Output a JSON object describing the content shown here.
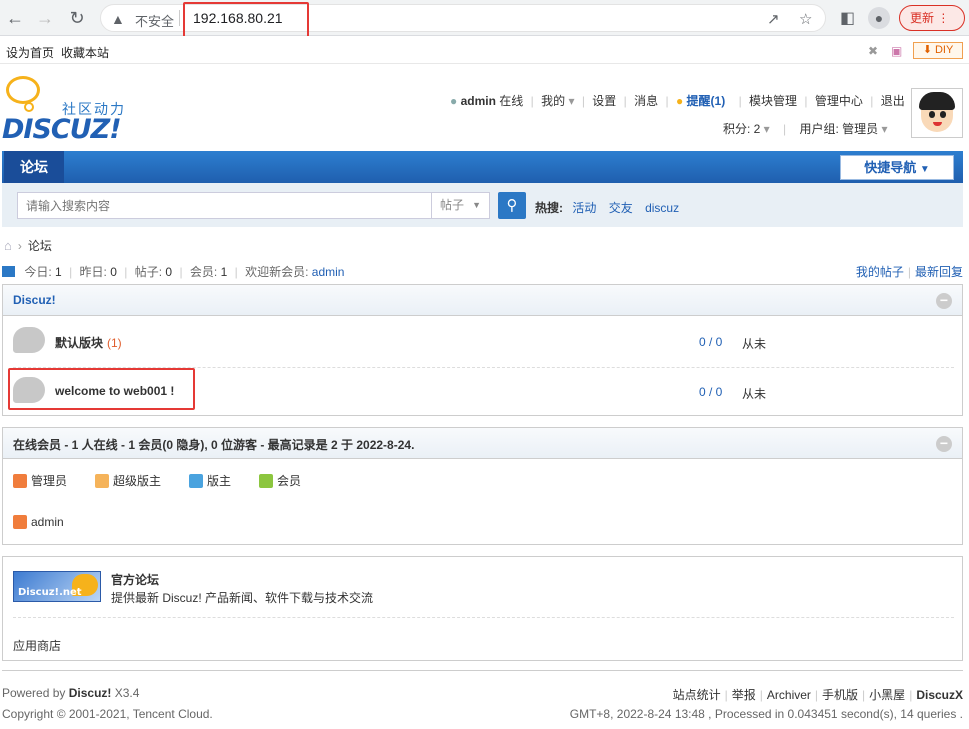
{
  "browser": {
    "insecure_label": "不安全",
    "url": "192.168.80.21",
    "update_label": "更新",
    "bookmarks": [
      "设为首页",
      "收藏本站"
    ],
    "diy_label": "DIY"
  },
  "logo": {
    "slogan": "社区动力",
    "brand": "DISCUZ!"
  },
  "userbar": {
    "username": "admin",
    "status": "在线",
    "links": [
      "我的",
      "设置",
      "消息",
      "提醒(1)",
      "模块管理",
      "管理中心",
      "退出"
    ],
    "credits": "积分: 2",
    "usergroup": "用户组: 管理员"
  },
  "nav": {
    "tab": "论坛",
    "quick_nav": "快捷导航"
  },
  "search": {
    "placeholder": "请输入搜索内容",
    "type": "帖子",
    "hot_label": "热搜:",
    "hot_keywords": [
      "活动",
      "交友",
      "discuz"
    ]
  },
  "breadcrumb": {
    "current": "论坛"
  },
  "stats": {
    "today_label": "今日:",
    "today": "1",
    "yesterday_label": "昨日:",
    "yesterday": "0",
    "posts_label": "帖子:",
    "posts": "0",
    "members_label": "会员:",
    "members": "1",
    "welcome_label": "欢迎新会员:",
    "new_member": "admin",
    "my_posts": "我的帖子",
    "latest_reply": "最新回复"
  },
  "category": {
    "title": "Discuz!",
    "forums": [
      {
        "name": "默认版块",
        "count": "(1)",
        "threads_posts": "0 / 0",
        "last": "从未"
      },
      {
        "name": "welcome to web001 !",
        "count": "",
        "threads_posts": "0 / 0",
        "last": "从未"
      }
    ]
  },
  "online": {
    "title": "在线会员 - 1 人在线 - 1 会员(0 隐身), 0 位游客 - 最高记录是 2 于 2022-8-24.",
    "legend": [
      {
        "label": "管理员",
        "color": "#f07d3c"
      },
      {
        "label": "超级版主",
        "color": "#f5b35a"
      },
      {
        "label": "版主",
        "color": "#4aa3df"
      },
      {
        "label": "会员",
        "color": "#8cc63f"
      }
    ],
    "users": [
      "admin"
    ]
  },
  "official": {
    "logo_text": "Discuz!.net",
    "title": "官方论坛",
    "desc": "提供最新 Discuz! 产品新闻、软件下载与技术交流",
    "app_store": "应用商店"
  },
  "footer": {
    "powered_prefix": "Powered by",
    "powered_brand": "Discuz!",
    "version": "X3.4",
    "copyright": "Copyright © 2001-2021, Tencent Cloud.",
    "links": [
      "站点统计",
      "举报",
      "Archiver",
      "手机版",
      "小黑屋"
    ],
    "brand_link": "DiscuzX",
    "process": "GMT+8, 2022-8-24 13:48 , Processed in 0.043451 second(s), 14 queries ."
  },
  "colors": {
    "accent": "#2160b4",
    "nav_blue": "#2d7fd0",
    "highlight_red": "#e53935"
  }
}
